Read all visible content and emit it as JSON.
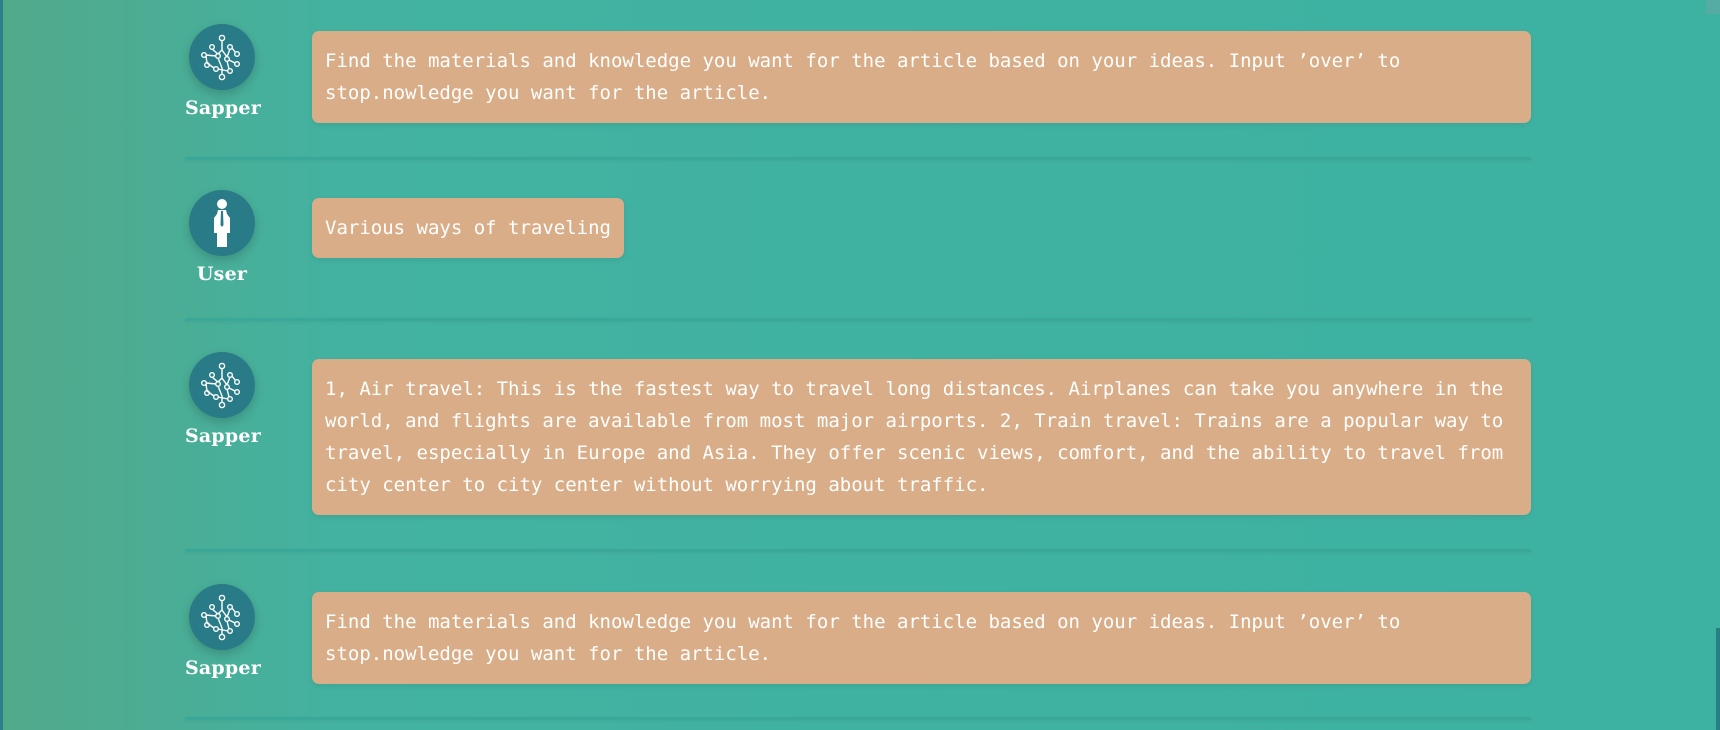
{
  "colors": {
    "background": "#3eb2a2",
    "bubble": "#d9ad87",
    "avatar": "#2a7b88",
    "text": "#ffffff"
  },
  "messages": [
    {
      "sender": "Sapper",
      "avatar_icon": "network-graph-icon",
      "text": "Find the materials and knowledge you want for the article based on your ideas. Input ’over’ to stop.nowledge you want for the article."
    },
    {
      "sender": "User",
      "avatar_icon": "person-icon",
      "text": "Various ways of traveling"
    },
    {
      "sender": "Sapper",
      "avatar_icon": "network-graph-icon",
      "text": "1, Air travel: This is the fastest way to travel long distances. Airplanes can take you anywhere in the world, and flights are available from most major airports. 2, Train travel: Trains are a popular way to travel, especially in Europe and Asia. They offer scenic views, comfort, and the ability to travel from city center to city center without worrying about traffic."
    },
    {
      "sender": "Sapper",
      "avatar_icon": "network-graph-icon",
      "text": "Find the materials and knowledge you want for the article based on your ideas. Input ’over’ to stop.nowledge you want for the article."
    }
  ]
}
